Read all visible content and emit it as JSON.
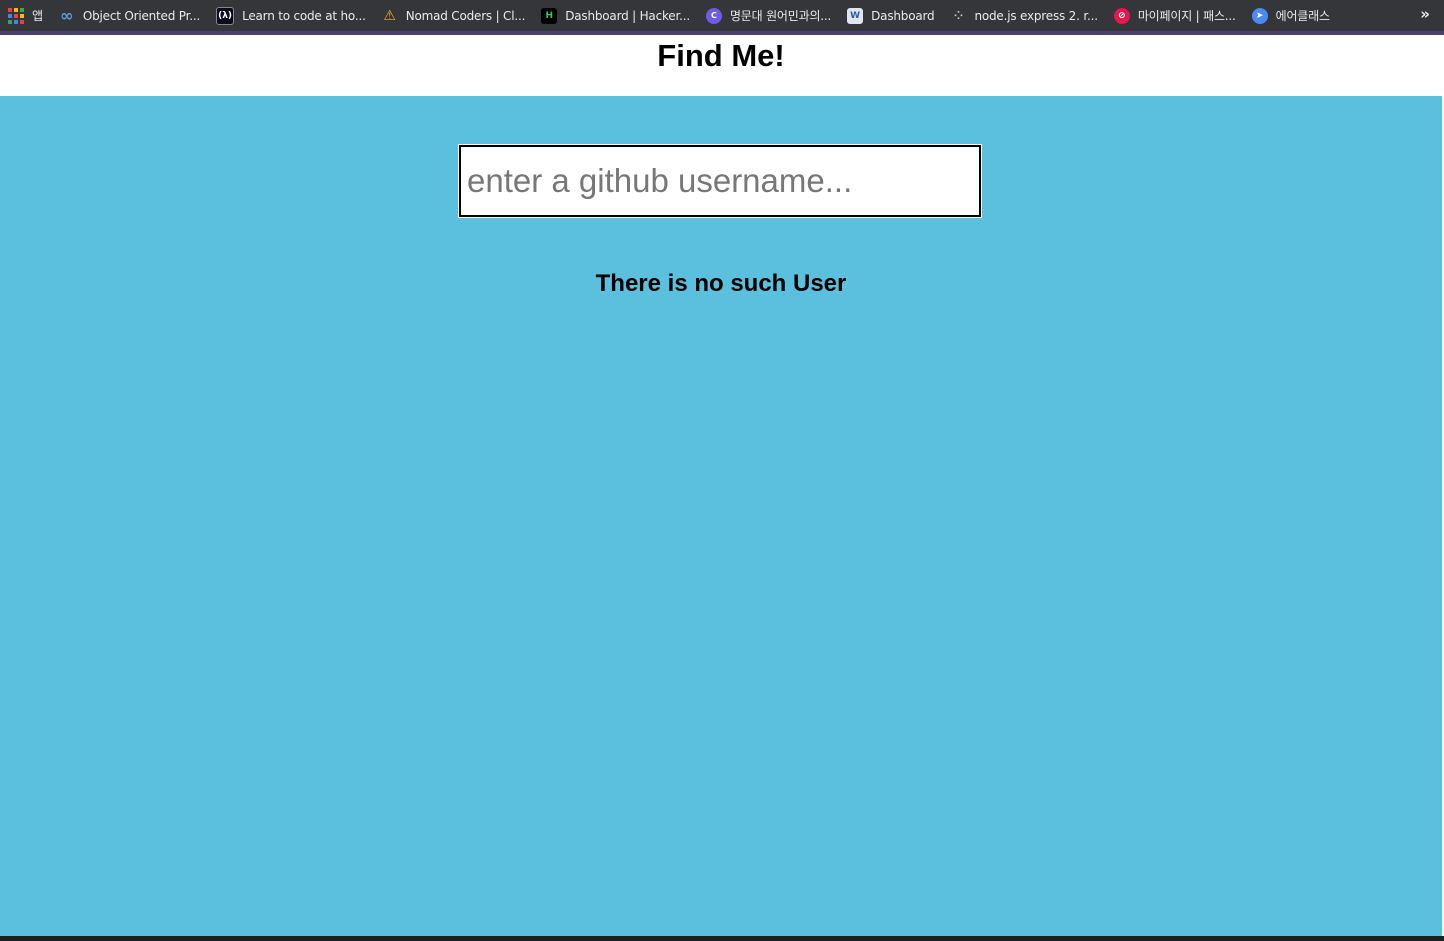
{
  "bookmarks": [
    {
      "label": "앱",
      "icon": "apps-grid-icon"
    },
    {
      "label": "Object Oriented Pr...",
      "icon": "infinity-icon"
    },
    {
      "label": "Learn to code at ho...",
      "icon": "freecodecamp-icon"
    },
    {
      "label": "Nomad Coders | Cl...",
      "icon": "nomad-coders-icon"
    },
    {
      "label": "Dashboard | Hacker...",
      "icon": "hackerrank-icon"
    },
    {
      "label": "명문대 원어민과의...",
      "icon": "chat-icon"
    },
    {
      "label": "Dashboard",
      "icon": "dashboard-icon"
    },
    {
      "label": "node.js express 2. r...",
      "icon": "dots-icon"
    },
    {
      "label": "마이페이지 | 패스...",
      "icon": "fastcampus-icon"
    },
    {
      "label": "에어클래스",
      "icon": "airclass-icon"
    }
  ],
  "bookmarks_more": "»",
  "page": {
    "title": "Find Me!",
    "search_placeholder": "enter a github username...",
    "search_value": "",
    "message": "There is no such User"
  },
  "colors": {
    "background": "#5bbfde",
    "header": "#ffffff",
    "bookmarks_bar": "#35363a"
  }
}
